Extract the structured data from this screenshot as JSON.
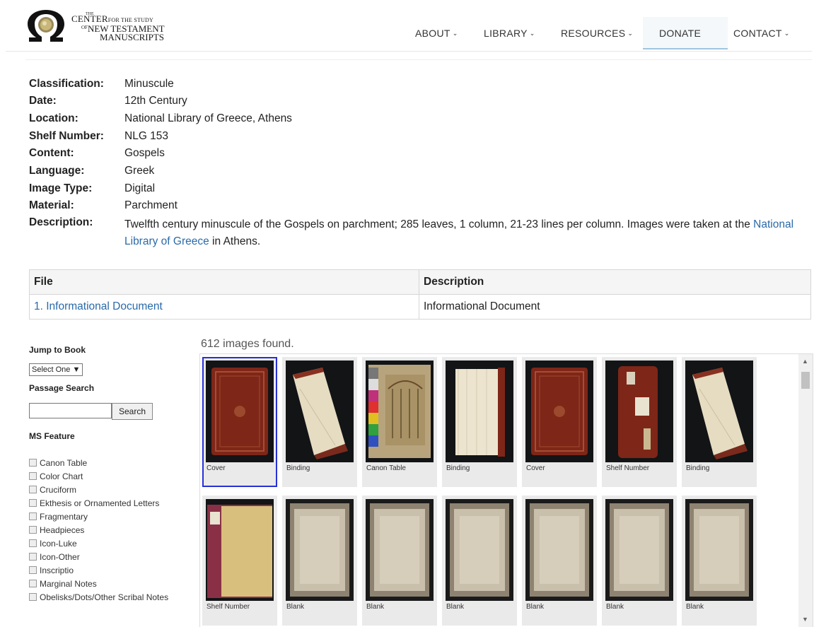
{
  "header": {
    "logo": {
      "line_the": "THE",
      "line1a": "CENTER",
      "line1b": "FOR THE STUDY",
      "line2a": "OF",
      "line2b": "NEW TESTAMENT",
      "line3": "MANUSCRIPTS"
    },
    "nav": [
      {
        "label": "ABOUT",
        "chevron": true
      },
      {
        "label": "LIBRARY",
        "chevron": true
      },
      {
        "label": "RESOURCES",
        "chevron": true
      },
      {
        "label": "DONATE",
        "chevron": false
      },
      {
        "label": "CONTACT",
        "chevron": true
      }
    ]
  },
  "details": {
    "classification": {
      "label": "Classification:",
      "value": "Minuscule"
    },
    "date": {
      "label": "Date:",
      "value": "12th Century"
    },
    "location": {
      "label": "Location:",
      "value": "National Library of Greece, Athens"
    },
    "shelf": {
      "label": "Shelf Number:",
      "value": "NLG 153"
    },
    "content": {
      "label": "Content:",
      "value": "Gospels"
    },
    "language": {
      "label": "Language:",
      "value": "Greek"
    },
    "image_type": {
      "label": "Image Type:",
      "value": "Digital"
    },
    "material": {
      "label": "Material:",
      "value": "Parchment"
    },
    "description": {
      "label": "Description:",
      "text_before": "Twelfth century minuscule of the Gospels on parchment; 285 leaves, 1 column, 21-23 lines per column. Images were taken at the ",
      "link": "National Library of Greece",
      "text_after": " in Athens."
    }
  },
  "files": {
    "col_file": "File",
    "col_description": "Description",
    "rows": [
      {
        "file": "1. Informational Document",
        "description": "Informational Document"
      }
    ]
  },
  "sidebar": {
    "jump_label": "Jump to Book",
    "jump_select": "Select One ▼",
    "passage_label": "Passage Search",
    "search_button": "Search",
    "feature_label": "MS Feature",
    "features": [
      "Canon Table",
      "Color Chart",
      "Cruciform",
      "Ekthesis or Ornamented Letters",
      "Fragmentary",
      "Headpieces",
      "Icon-Luke",
      "Icon-Other",
      "Inscriptio",
      "Marginal Notes",
      "Obelisks/Dots/Other Scribal Notes"
    ]
  },
  "gallery": {
    "count_text": "612 images found.",
    "images": [
      {
        "caption": "Cover",
        "kind": "cover",
        "selected": true
      },
      {
        "caption": "Binding",
        "kind": "binding-open"
      },
      {
        "caption": "Canon Table",
        "kind": "canon"
      },
      {
        "caption": "Binding",
        "kind": "binding-edge"
      },
      {
        "caption": "Cover",
        "kind": "cover"
      },
      {
        "caption": "Shelf Number",
        "kind": "spine"
      },
      {
        "caption": "Binding",
        "kind": "binding-open"
      },
      {
        "caption": "Shelf Number",
        "kind": "shelf-open"
      },
      {
        "caption": "Blank",
        "kind": "blank"
      },
      {
        "caption": "Blank",
        "kind": "blank"
      },
      {
        "caption": "Blank",
        "kind": "blank"
      },
      {
        "caption": "Blank",
        "kind": "blank"
      },
      {
        "caption": "Blank",
        "kind": "blank"
      },
      {
        "caption": "Blank",
        "kind": "blank"
      }
    ]
  },
  "colors": {
    "link": "#2a6aa9",
    "selected_border": "#2730d8",
    "leather": "#8a2a1c",
    "parchment": "#d8cfb8"
  }
}
